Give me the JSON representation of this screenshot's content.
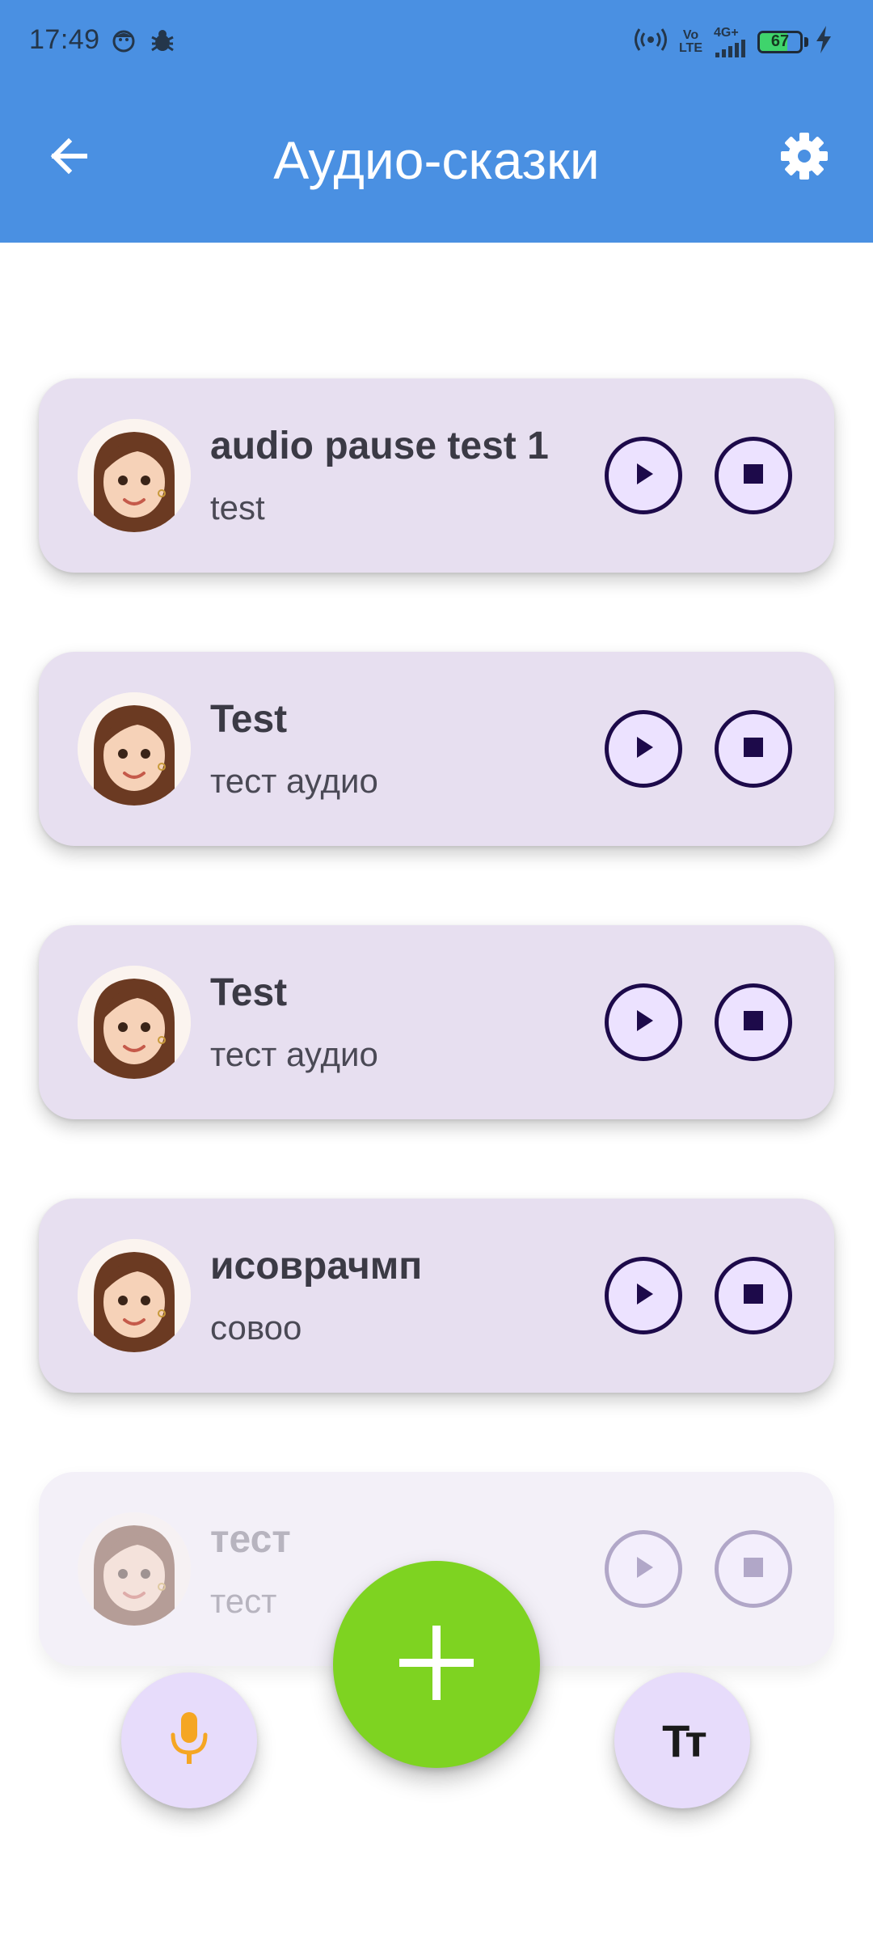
{
  "status_bar": {
    "time": "17:49",
    "volte_line1": "Vo",
    "volte_line2": "LTE",
    "network": "4G+",
    "battery": "67",
    "battery_level": 0.67
  },
  "app_bar": {
    "title": "Аудио-сказки"
  },
  "colors": {
    "app_bar": "#4a90e2",
    "card": "#e7dff0",
    "fab_add": "#7ed321",
    "fab_secondary": "#e7dcfb",
    "mic_icon": "#f5a623",
    "button_outline": "#1d0a4a"
  },
  "icons": {
    "back": "arrow-back-icon",
    "settings": "gear-icon",
    "play": "play-icon",
    "stop": "stop-icon",
    "add": "plus-icon",
    "mic": "microphone-icon",
    "text_size": "text-size-icon"
  },
  "stories": [
    {
      "title": "audio pause test 1",
      "subtitle": "test"
    },
    {
      "title": "Test",
      "subtitle": "тест аудио"
    },
    {
      "title": "Test",
      "subtitle": "тест аудио"
    },
    {
      "title": "исоврачмп",
      "subtitle": "совоо"
    },
    {
      "title": "тест",
      "subtitle": "тест"
    }
  ],
  "text_size_glyph": "Tт"
}
